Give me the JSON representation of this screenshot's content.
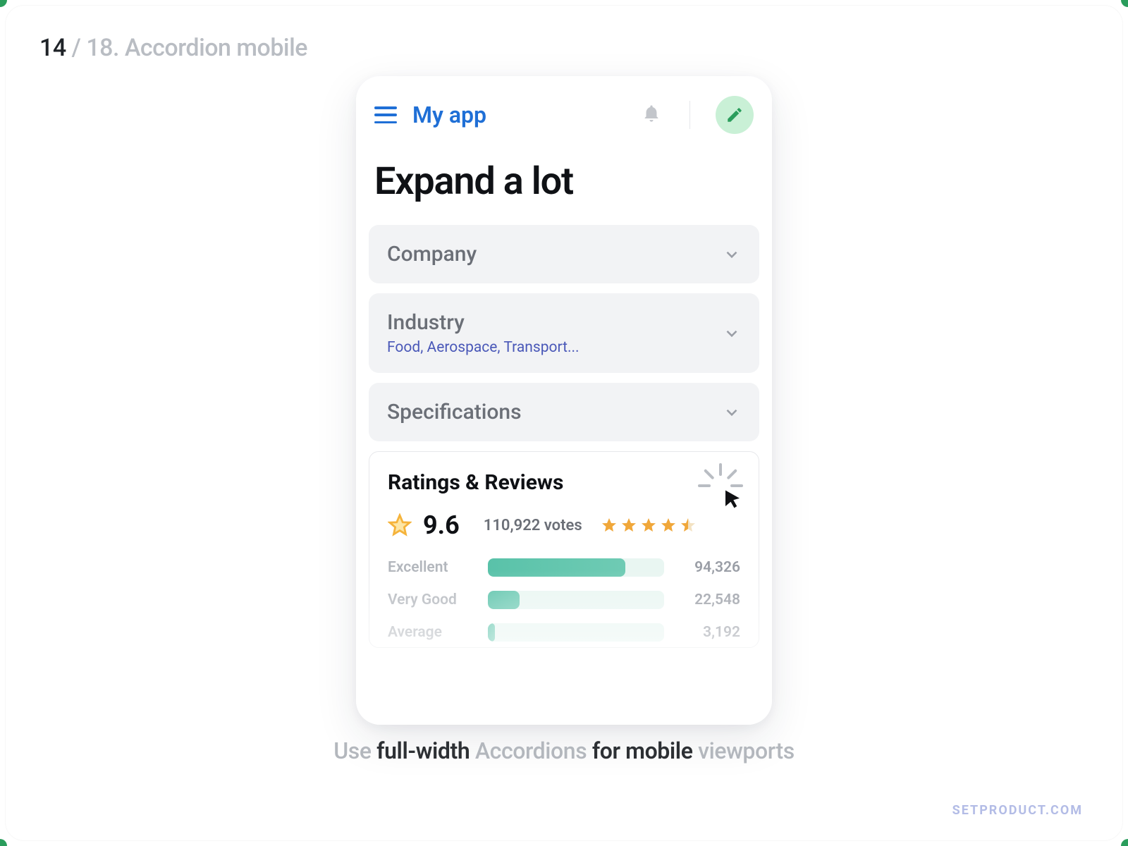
{
  "slide": {
    "index": "14",
    "total": "18",
    "title": "Accordion mobile"
  },
  "app": {
    "title": "My app"
  },
  "page": {
    "heading": "Expand a lot"
  },
  "accordions": [
    {
      "label": "Company",
      "sub": ""
    },
    {
      "label": "Industry",
      "sub": "Food, Aerospace, Transport..."
    },
    {
      "label": "Specifications",
      "sub": ""
    }
  ],
  "ratings": {
    "title": "Ratings & Reviews",
    "score": "9.6",
    "votes": "110,922 votes",
    "stars": 4.5,
    "rows": [
      {
        "label": "Excellent",
        "count": "94,326",
        "pct": 78
      },
      {
        "label": "Very Good",
        "count": "22,548",
        "pct": 18
      },
      {
        "label": "Average",
        "count": "3,192",
        "pct": 4
      }
    ]
  },
  "caption": {
    "p1": "Use ",
    "s1": "full-width ",
    "p2": "Accordions ",
    "s2": "for mobile ",
    "p3": "viewports"
  },
  "watermark": "SETPRODUCT.COM"
}
